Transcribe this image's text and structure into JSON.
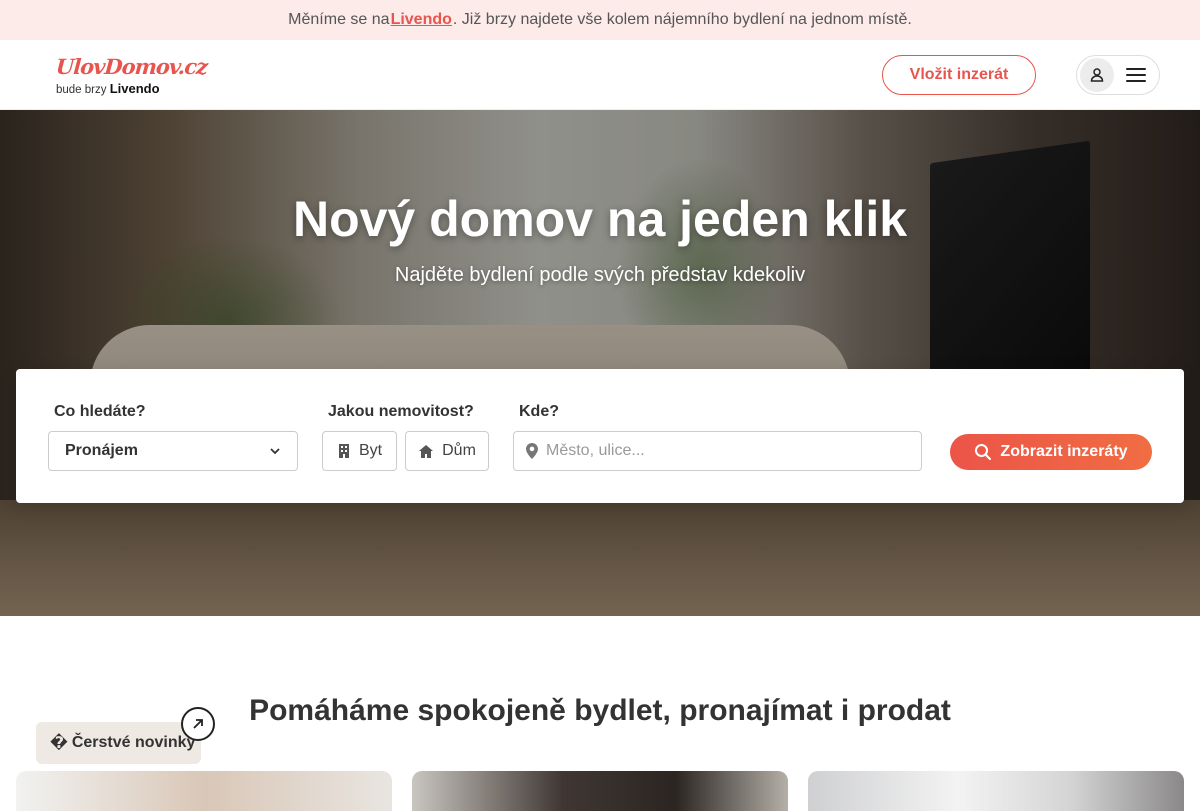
{
  "announcement": {
    "before": "Měníme se na ",
    "link": "Livendo",
    "after": ". Již brzy najdete vše kolem nájemního bydlení na jednom místě."
  },
  "header": {
    "logo_main": "UlovDomov.cz",
    "logo_sub": "bude brzy",
    "logo_sub_brand": "Livendo",
    "post_button": "Vložit inzerát"
  },
  "hero": {
    "title": "Nový domov na jeden klik",
    "subtitle": "Najděte bydlení podle svých představ kdekoliv"
  },
  "search": {
    "what_label": "Co hledáte?",
    "what_value": "Pronájem",
    "type_label": "Jakou nemovitost?",
    "type_options": [
      "Byt",
      "Dům"
    ],
    "where_label": "Kde?",
    "where_placeholder": "Město, ulice...",
    "submit": "Zobrazit inzeráty"
  },
  "section": {
    "title": "Pomáháme spokojeně bydlet, pronajímat i prodat",
    "badge": "Čerstvé novinky"
  },
  "colors": {
    "accent": "#e8554e",
    "announce_bg": "#fcebe9"
  }
}
